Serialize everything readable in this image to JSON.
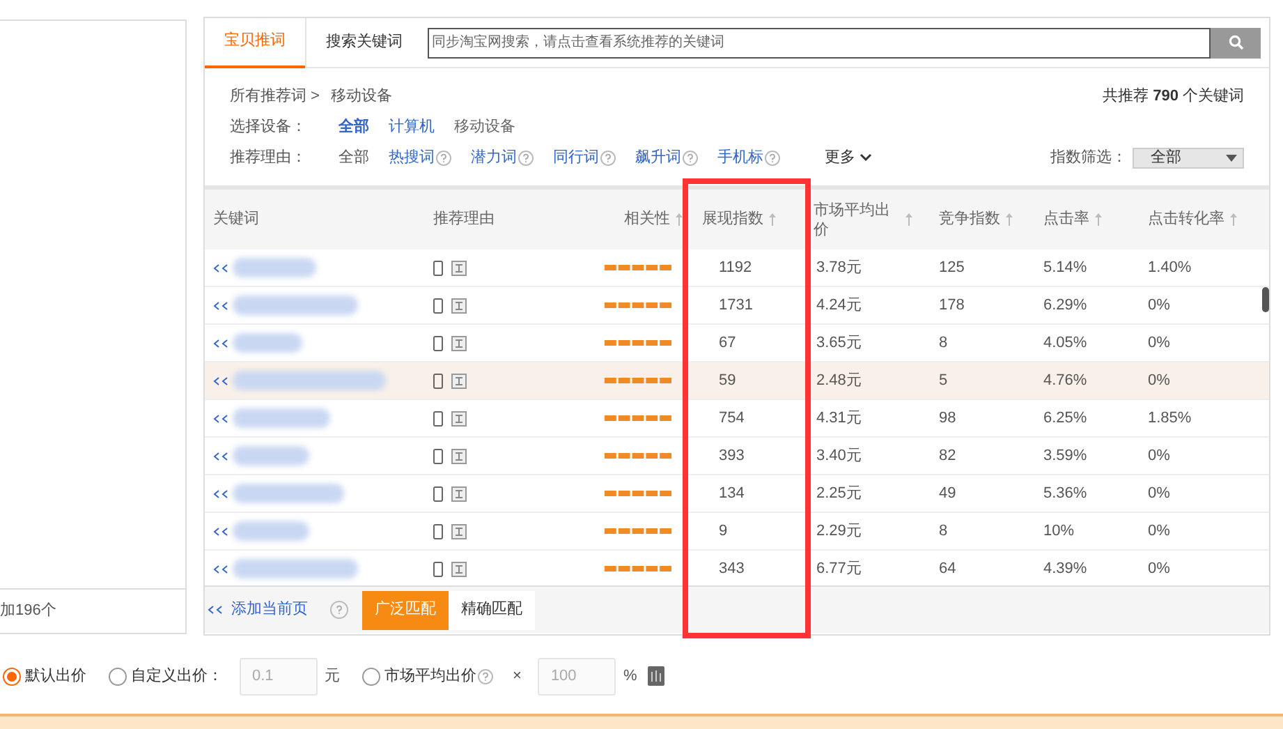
{
  "left_panel": {
    "footer": "加196个"
  },
  "tabs": [
    {
      "label": "宝贝推词",
      "selected": true
    },
    {
      "label": "搜索关键词",
      "selected": false
    }
  ],
  "search": {
    "placeholder": "同步淘宝网搜索，请点击查看系统推荐的关键词"
  },
  "breadcrumb": {
    "root": "所有推荐词 >",
    "current": "移动设备"
  },
  "total": {
    "prefix": "共推荐",
    "count": "790",
    "suffix": "个关键词"
  },
  "device_filter": {
    "label": "选择设备：",
    "options": [
      {
        "label": "全部",
        "selected": true
      },
      {
        "label": "计算机",
        "selected": false
      },
      {
        "label": "移动设备",
        "selected": false
      }
    ]
  },
  "reason_filter": {
    "label": "推荐理由：",
    "options": [
      {
        "label": "全部",
        "selected": false,
        "help": false
      },
      {
        "label": "热搜词",
        "selected": false,
        "help": true
      },
      {
        "label": "潜力词",
        "selected": false,
        "help": true
      },
      {
        "label": "同行词",
        "selected": false,
        "help": true
      },
      {
        "label": "飙升词",
        "selected": false,
        "help": true
      },
      {
        "label": "手机标",
        "selected": false,
        "help": true
      }
    ],
    "more": "更多"
  },
  "index_filter": {
    "label": "指数筛选：",
    "value": "全部"
  },
  "table": {
    "columns": [
      "关键词",
      "推荐理由",
      "相关性",
      "展现指数",
      "市场平均出价",
      "竞争指数",
      "点击率",
      "点击转化率"
    ],
    "rows": [
      {
        "selected": false,
        "cells": [
          "",
          "",
          "",
          "1192",
          "3.78元",
          "125",
          "5.14%",
          "1.40%"
        ]
      },
      {
        "selected": false,
        "cells": [
          "",
          "",
          "",
          "1731",
          "4.24元",
          "178",
          "6.29%",
          "0%"
        ]
      },
      {
        "selected": false,
        "cells": [
          "",
          "",
          "",
          "67",
          "3.65元",
          "8",
          "4.05%",
          "0%"
        ]
      },
      {
        "selected": true,
        "cells": [
          "",
          "",
          "",
          "59",
          "2.48元",
          "5",
          "4.76%",
          "0%"
        ]
      },
      {
        "selected": false,
        "cells": [
          "",
          "",
          "",
          "754",
          "4.31元",
          "98",
          "6.25%",
          "1.85%"
        ]
      },
      {
        "selected": false,
        "cells": [
          "",
          "",
          "",
          "393",
          "3.40元",
          "82",
          "3.59%",
          "0%"
        ]
      },
      {
        "selected": false,
        "cells": [
          "",
          "",
          "",
          "134",
          "2.25元",
          "49",
          "5.36%",
          "0%"
        ]
      },
      {
        "selected": false,
        "cells": [
          "",
          "",
          "",
          "9",
          "2.29元",
          "8",
          "10%",
          "0%"
        ]
      },
      {
        "selected": false,
        "cells": [
          "",
          "",
          "",
          "343",
          "6.77元",
          "64",
          "4.39%",
          "0%"
        ]
      }
    ]
  },
  "footer": {
    "add_link": "添加当前页",
    "match_buttons": [
      {
        "label": "广泛匹配",
        "selected": true
      },
      {
        "label": "精确匹配",
        "selected": false
      }
    ]
  },
  "bid_options": [
    {
      "kind": "plain",
      "label": "默认出价",
      "selected": true
    },
    {
      "kind": "amount",
      "label": "自定义出价：",
      "selected": false,
      "placeholder": "0.1",
      "unit": "元"
    },
    {
      "kind": "percent",
      "label": "市场平均出价",
      "selected": false,
      "times": "×",
      "placeholder": "100",
      "unit": "%"
    }
  ]
}
